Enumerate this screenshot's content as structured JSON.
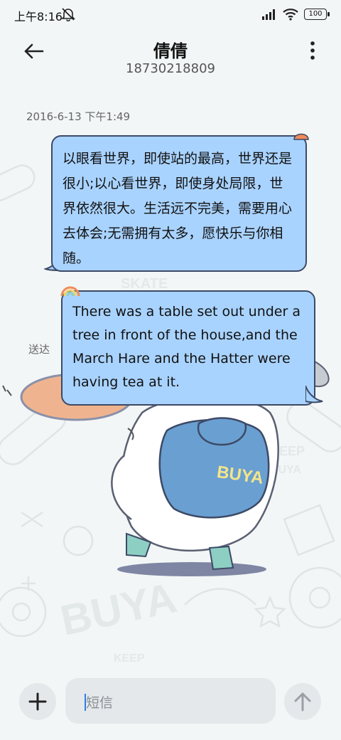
{
  "status_bar": {
    "time": "上午8:16",
    "battery": "100"
  },
  "header": {
    "contact_name": "倩倩",
    "contact_number": "18730218809"
  },
  "conversation": {
    "timestamp": "2016-6-13 下午1:49",
    "messages": [
      {
        "text": "以眼看世界，即使站的最高，世界还是很小;以心看世界，即使身处局限，世界依然很大。生活远不完美，需要用心去体会;无需拥有太多，愿快乐与你相随。"
      },
      {
        "text": "There was a table set out under a tree in front of the house,and the March Hare and the Hatter were having tea at it."
      }
    ],
    "sent_status": "送达"
  },
  "background": {
    "brand_text": "BUYA",
    "doodle_text": [
      "SKATE",
      "KEEP",
      "BUYA",
      "KEEP"
    ]
  },
  "composer": {
    "placeholder": "短信"
  },
  "colors": {
    "bubble": "#a9d3ff",
    "bubble_border": "#3c4a66",
    "background": "#f3f6f6",
    "accent": "#2b7de9"
  },
  "icons": {
    "back": "arrow-left-icon",
    "more": "more-vertical-icon",
    "add": "plus-icon",
    "send": "arrow-up-icon"
  }
}
